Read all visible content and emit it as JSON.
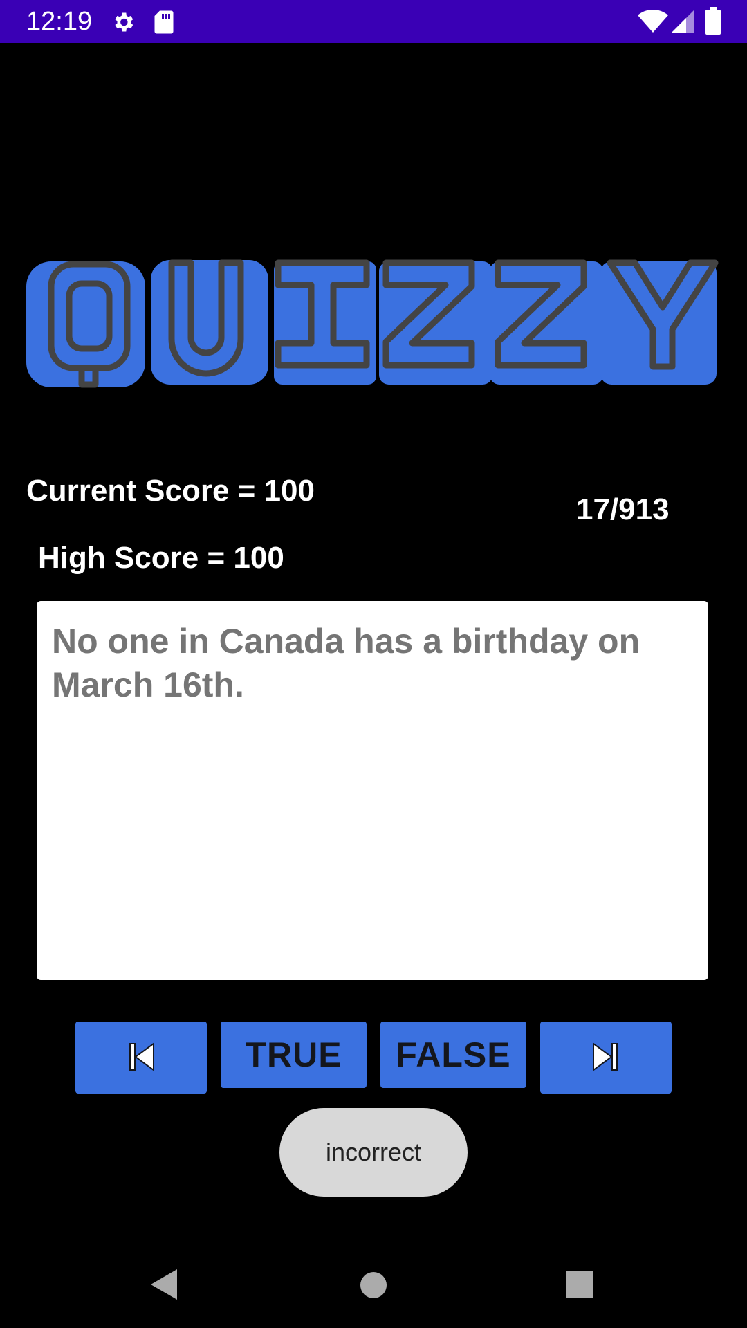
{
  "status_bar": {
    "time": "12:19",
    "icons": [
      "settings-icon",
      "sd-card-icon",
      "wifi-icon",
      "signal-icon",
      "battery-icon"
    ],
    "background_color": "#3a00b5"
  },
  "logo": {
    "text": "QUIZZY",
    "fill_color": "#3b71e0",
    "stroke_color": "#444444"
  },
  "scores": {
    "current": "Current Score = 100",
    "high": "High Score = 100"
  },
  "progress": "17/913",
  "question": {
    "text": "No one in Canada has a birthday on March 16th."
  },
  "buttons": {
    "previous_icon": "skip-previous-icon",
    "true_label": "TRUE",
    "false_label": "FALSE",
    "next_icon": "skip-next-icon",
    "color": "#3b71e0"
  },
  "toast": {
    "text": "incorrect"
  },
  "nav_bar": {
    "icons": [
      "back-icon",
      "home-icon",
      "recents-icon"
    ]
  }
}
